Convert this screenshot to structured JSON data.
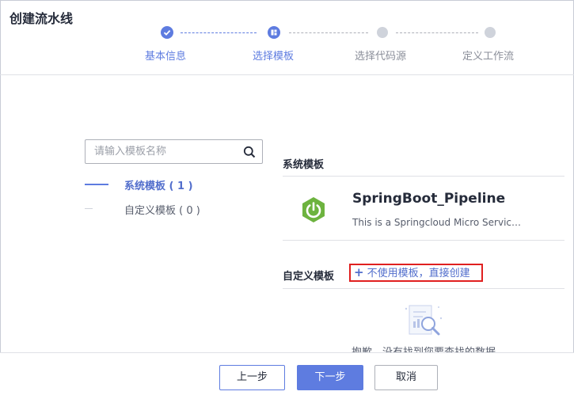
{
  "window": {
    "title": "创建流水线"
  },
  "steps": [
    {
      "label": "基本信息",
      "state": "done"
    },
    {
      "label": "选择模板",
      "state": "active"
    },
    {
      "label": "选择代码源",
      "state": "todo"
    },
    {
      "label": "定义工作流",
      "state": "todo"
    }
  ],
  "search": {
    "placeholder": "请输入模板名称",
    "value": ""
  },
  "categories": [
    {
      "label": "系统模板 ( 1 )",
      "active": true
    },
    {
      "label": "自定义模板 ( 0 )",
      "active": false
    }
  ],
  "system_templates": {
    "title": "系统模板",
    "items": [
      {
        "name": "SpringBoot_Pipeline",
        "description": "This is a Springcloud Micro Service Te...",
        "icon": "spring-power-icon"
      }
    ]
  },
  "custom_templates": {
    "title": "自定义模板",
    "create_link": "不使用模板，直接创建",
    "empty_text": "抱歉，没有找到您要查找的数据"
  },
  "footer": {
    "prev": "上一步",
    "next": "下一步",
    "cancel": "取消"
  },
  "colors": {
    "accent": "#5e7ce0",
    "spring_green": "#6db33f",
    "highlight_border": "#e02020"
  }
}
